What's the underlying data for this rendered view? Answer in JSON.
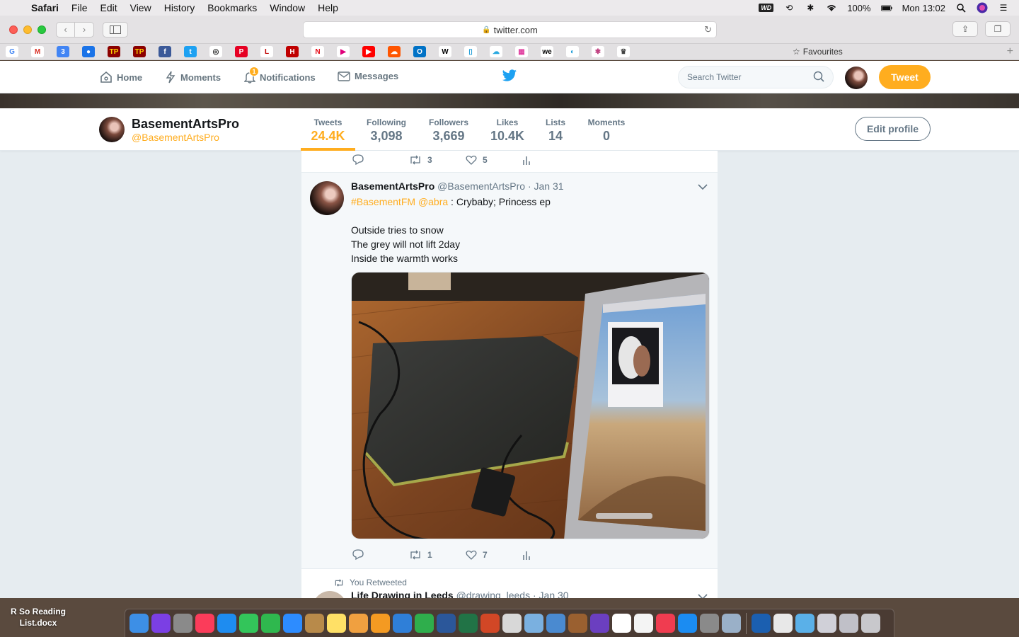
{
  "menubar": {
    "app": "Safari",
    "items": [
      "File",
      "Edit",
      "View",
      "History",
      "Bookmarks",
      "Window",
      "Help"
    ],
    "wd": "WD",
    "battery": "100%",
    "clock": "Mon 13:02"
  },
  "browser": {
    "url": "twitter.com",
    "favourites": "Favourites"
  },
  "bookmarks": [
    {
      "icon": "google-icon",
      "glyph": "G",
      "color": "#ffffff",
      "fg": "#4285f4"
    },
    {
      "icon": "gmail-icon",
      "glyph": "M",
      "color": "#ffffff",
      "fg": "#d93025"
    },
    {
      "icon": "calendar-icon",
      "glyph": "3",
      "color": "#4285f4",
      "fg": "#ffffff"
    },
    {
      "icon": "contacts-icon",
      "glyph": "●",
      "color": "#1a73e8",
      "fg": "#ffffff"
    },
    {
      "icon": "tp-icon",
      "glyph": "TP",
      "color": "#8b0000",
      "fg": "#ffd200"
    },
    {
      "icon": "tp2-icon",
      "glyph": "TP",
      "color": "#8b0000",
      "fg": "#ffd200"
    },
    {
      "icon": "facebook-icon",
      "glyph": "f",
      "color": "#3b5998",
      "fg": "#ffffff"
    },
    {
      "icon": "twitter-icon",
      "glyph": "t",
      "color": "#1da1f2",
      "fg": "#ffffff"
    },
    {
      "icon": "instagram-icon",
      "glyph": "◎",
      "color": "#ffffff",
      "fg": "#222222"
    },
    {
      "icon": "pinterest-icon",
      "glyph": "P",
      "color": "#e60023",
      "fg": "#ffffff"
    },
    {
      "icon": "life-icon",
      "glyph": "L",
      "color": "#ffffff",
      "fg": "#c00000"
    },
    {
      "icon": "h-icon",
      "glyph": "H",
      "color": "#c00000",
      "fg": "#ffffff"
    },
    {
      "icon": "netflix-icon",
      "glyph": "N",
      "color": "#ffffff",
      "fg": "#e50914"
    },
    {
      "icon": "play-icon",
      "glyph": "▶",
      "color": "#ffffff",
      "fg": "#e0007a"
    },
    {
      "icon": "youtube-icon",
      "glyph": "▶",
      "color": "#ff0000",
      "fg": "#ffffff"
    },
    {
      "icon": "soundcloud-icon",
      "glyph": "☁",
      "color": "#ff5500",
      "fg": "#ffffff"
    },
    {
      "icon": "outlook-icon",
      "glyph": "O",
      "color": "#0072c6",
      "fg": "#ffffff"
    },
    {
      "icon": "w-icon",
      "glyph": "W",
      "color": "#ffffff",
      "fg": "#000000"
    },
    {
      "icon": "tablet-icon",
      "glyph": "▯",
      "color": "#ffffff",
      "fg": "#1a9ad6"
    },
    {
      "icon": "cloud-icon",
      "glyph": "☁",
      "color": "#ffffff",
      "fg": "#29a8e0"
    },
    {
      "icon": "colors-icon",
      "glyph": "▦",
      "color": "#ffffff",
      "fg": "#e040a0"
    },
    {
      "icon": "we-icon",
      "glyph": "we",
      "color": "#ffffff",
      "fg": "#000000"
    },
    {
      "icon": "chat-icon",
      "glyph": "◐",
      "color": "#ffffff",
      "fg": "#1a9ad6"
    },
    {
      "icon": "star-multi-icon",
      "glyph": "✱",
      "color": "#ffffff",
      "fg": "#c04080"
    },
    {
      "icon": "crown-icon",
      "glyph": "♛",
      "color": "#ffffff",
      "fg": "#444444"
    }
  ],
  "twitter_nav": {
    "home": "Home",
    "moments": "Moments",
    "notifications": "Notifications",
    "notif_count": "1",
    "messages": "Messages",
    "search_placeholder": "Search Twitter",
    "tweet_button": "Tweet"
  },
  "profile": {
    "name": "BasementArtsPro",
    "handle": "@BasementArtsPro",
    "stats": [
      {
        "label": "Tweets",
        "value": "24.4K"
      },
      {
        "label": "Following",
        "value": "3,098"
      },
      {
        "label": "Followers",
        "value": "3,669"
      },
      {
        "label": "Likes",
        "value": "10.4K"
      },
      {
        "label": "Lists",
        "value": "14"
      },
      {
        "label": "Moments",
        "value": "0"
      }
    ],
    "edit_button": "Edit profile"
  },
  "prev_tweet_actions": {
    "retweets": "3",
    "likes": "5"
  },
  "tweet": {
    "name": "BasementArtsPro",
    "handle": "@BasementArtsPro",
    "date": "· Jan 31",
    "hashtag": "#BasementFM",
    "mention": "@abra",
    "line1_rest": " : Crybaby; Princess ep",
    "poem": [
      "Outside tries to snow",
      "The grey will not lift 2day",
      "Inside the warmth works"
    ],
    "retweets": "1",
    "likes": "7"
  },
  "next_tweet": {
    "retweeted_label": "You Retweeted",
    "name": "Life Drawing in Leeds",
    "handle": "@drawing_leeds",
    "date": "· Jan 30"
  },
  "desktop": {
    "file_label_1": "R So Reading",
    "file_label_2": "List.docx"
  },
  "dock": [
    {
      "icon": "finder-icon",
      "color": "#3d8fe6"
    },
    {
      "icon": "siri-icon",
      "color": "#7b3fe4"
    },
    {
      "icon": "launchpad-icon",
      "color": "#8a8a8a"
    },
    {
      "icon": "music-icon",
      "color": "#fb3c5a"
    },
    {
      "icon": "safari-icon",
      "color": "#1e8cf0"
    },
    {
      "icon": "messages-icon",
      "color": "#33c55a"
    },
    {
      "icon": "facetime-icon",
      "color": "#2fb84e"
    },
    {
      "icon": "zoom-icon",
      "color": "#2d8cff"
    },
    {
      "icon": "notebook-icon",
      "color": "#b88a4a"
    },
    {
      "icon": "notes-icon",
      "color": "#ffe066"
    },
    {
      "icon": "photos-icon",
      "color": "#f0a040"
    },
    {
      "icon": "pages-icon",
      "color": "#f49a22"
    },
    {
      "icon": "keynote-icon",
      "color": "#2f7fd8"
    },
    {
      "icon": "numbers-icon",
      "color": "#2fae4c"
    },
    {
      "icon": "word-icon",
      "color": "#2b579a"
    },
    {
      "icon": "excel-icon",
      "color": "#217346"
    },
    {
      "icon": "powerpoint-icon",
      "color": "#d24726"
    },
    {
      "icon": "textedit-icon",
      "color": "#d8d8d8"
    },
    {
      "icon": "preview-icon",
      "color": "#7ab0e0"
    },
    {
      "icon": "photo-viewer-icon",
      "color": "#4a8ad0"
    },
    {
      "icon": "guitar-icon",
      "color": "#9a6030"
    },
    {
      "icon": "imovie-icon",
      "color": "#6b3fc0"
    },
    {
      "icon": "calendar-dock-icon",
      "color": "#ffffff"
    },
    {
      "icon": "reminders-icon",
      "color": "#f4f4f4"
    },
    {
      "icon": "news-icon",
      "color": "#f03c50"
    },
    {
      "icon": "appstore-icon",
      "color": "#1b8cf2"
    },
    {
      "icon": "settings-icon",
      "color": "#8a8a8a"
    },
    {
      "icon": "scanner-icon",
      "color": "#9ab0c8"
    },
    {
      "icon": "wd-icon",
      "color": "#1b5fb0"
    },
    {
      "icon": "chrome-icon",
      "color": "#e8e8e8"
    },
    {
      "icon": "folder-icon",
      "color": "#5ab0e8"
    },
    {
      "icon": "documents-icon",
      "color": "#d0d0d8"
    },
    {
      "icon": "stack-icon",
      "color": "#c0c0c8"
    },
    {
      "icon": "trash-icon",
      "color": "#c8c8cc"
    }
  ]
}
